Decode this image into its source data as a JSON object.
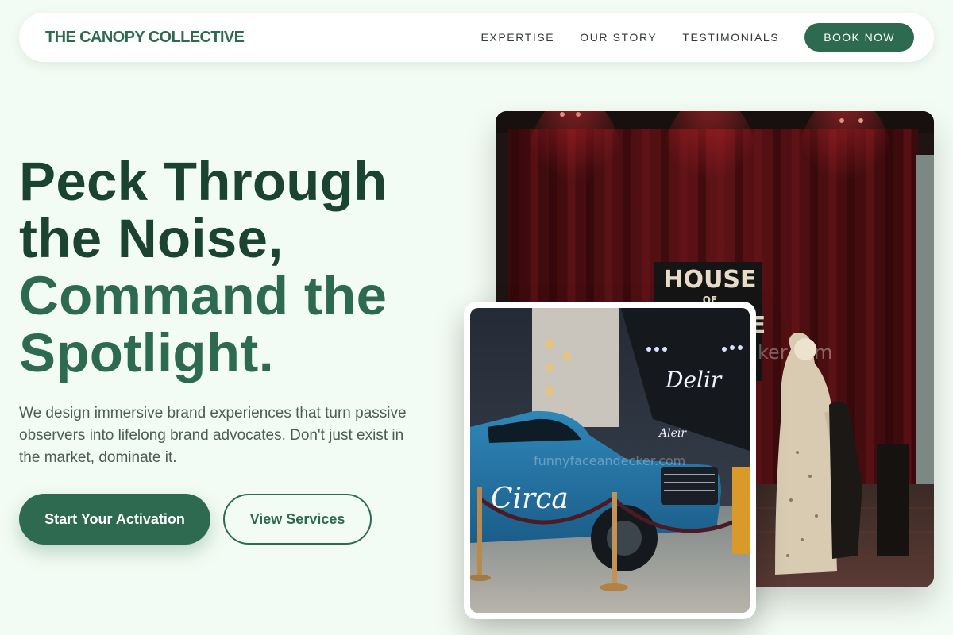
{
  "nav": {
    "brand": "THE CANOPY COLLECTIVE",
    "links": [
      "EXPERTISE",
      "OUR STORY",
      "TESTIMONIALS"
    ],
    "cta": "BOOK NOW"
  },
  "hero": {
    "headline_dark": [
      "Peck Through",
      "the Noise,"
    ],
    "headline_accent": [
      "Command the",
      "Spotlight."
    ],
    "subtext": "We design immersive brand experiences that turn passive observers into lifelong brand advocates. Don't just exist in the market, dominate it.",
    "primary_cta": "Start Your Activation",
    "secondary_cta": "View Services"
  },
  "images": {
    "back": {
      "sign_line1": "HOUSE",
      "sign_line2": "OF",
      "sign_line3": "E",
      "watermark": "ker.com"
    },
    "front": {
      "truck_text": "Circa",
      "neon_text": "Delir",
      "neon_small": "Aleir",
      "watermark": "funnyfaceandecker.com"
    }
  },
  "colors": {
    "brand_green": "#2d6a4f",
    "dark_green": "#1b4332",
    "background": "#f3fcf4"
  }
}
